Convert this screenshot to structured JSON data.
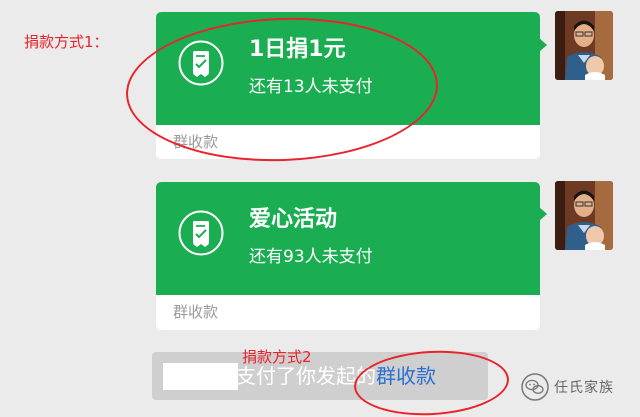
{
  "annotations": {
    "method1_label": "捐款方式1：",
    "method2_label": "捐款方式2"
  },
  "messages": [
    {
      "title": "1日捐1元",
      "subtitle": "还有13人未支付",
      "footer": "群收款",
      "icon": "receipt-check-icon"
    },
    {
      "title": "爱心活动",
      "subtitle": "还有93人未支付",
      "footer": "群收款",
      "icon": "receipt-check-icon"
    }
  ],
  "notice": {
    "text": "支付了你发起的",
    "link": "群收款"
  },
  "watermark": {
    "text": "任氏家族",
    "icon": "wechat-official-account-icon"
  },
  "colors": {
    "bubble_green": "#1aad52",
    "annotation_red": "#e8232b",
    "link_blue": "#2a6fcf",
    "background": "#ebebeb"
  }
}
